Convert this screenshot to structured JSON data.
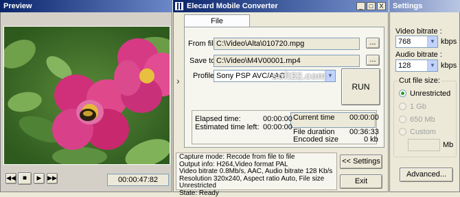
{
  "preview": {
    "title": "Preview",
    "time": "00:00:47:82"
  },
  "converter": {
    "title": "Elecard Mobile Converter",
    "window_min": "_",
    "window_max": "□",
    "window_close": "X",
    "tab_file": "File",
    "from_label": "From file:",
    "from_value": "C:\\Video\\Alta\\010720.mpg",
    "save_label": "Save to:",
    "save_value": "C:\\Video\\M4V00001.mp4",
    "browse_label": "...",
    "profile_label": "Profile:",
    "profile_value": "Sony PSP AVC/AAC",
    "run_label": "RUN",
    "expand_arrow": "›",
    "elapsed_label": "Elapsed time:",
    "elapsed_value": "00:00:00",
    "left_label": "Estimated time left:",
    "left_value": "00:00:00",
    "current_label": "Current time",
    "current_value": "00:00:00",
    "duration_label": "File duration",
    "duration_value": "00:36:33",
    "encoded_label": "Encoded size",
    "encoded_value": "0 kb",
    "status_lines": [
      "Capture mode: Recode from file to file",
      "Output info: H264,Video format PAL",
      "Video bitrate 0.8Mb/s, AAC, Audio bitrate 128 Kb/s",
      "Resolution 320x240, Aspect ratio Auto, File size Unrestricted",
      "State: Ready"
    ],
    "settings_button": "<< Settings",
    "exit_button": "Exit",
    "watermark": "soft32.com"
  },
  "settings": {
    "title": "Settings",
    "video_bitrate_label": "Video bitrate :",
    "video_bitrate_value": "768",
    "video_unit": "kbps",
    "audio_bitrate_label": "Audio bitrate :",
    "audio_bitrate_value": "128",
    "audio_unit": "kbps",
    "cut_label": "Cut file size:",
    "options": [
      "Unrestricted",
      "1 Gb",
      "650 Mb",
      "Custom"
    ],
    "custom_unit": "Mb",
    "advanced_button": "Advanced..."
  },
  "colors": {
    "title_gradient_start": "#0a246a",
    "title_gradient_end": "#6c88c8",
    "panel": "#ece9d8"
  }
}
